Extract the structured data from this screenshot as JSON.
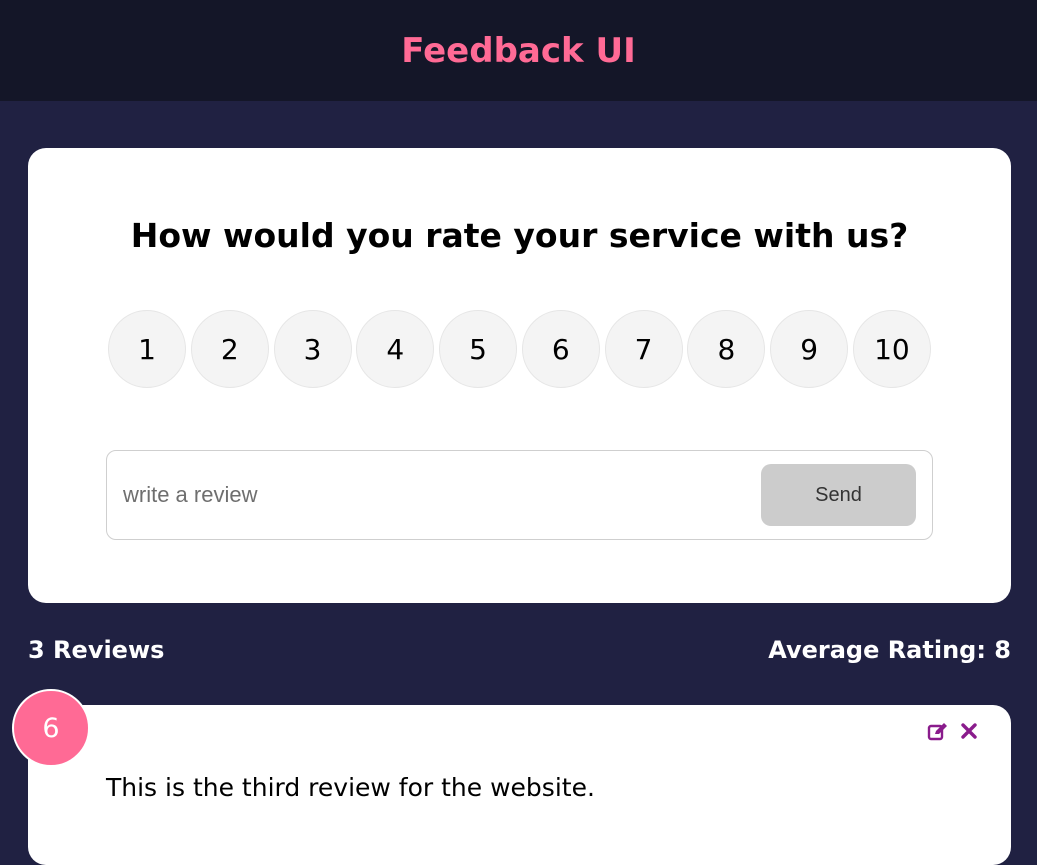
{
  "header": {
    "title": "Feedback UI"
  },
  "form": {
    "question": "How would you rate your service with us?",
    "ratings": [
      "1",
      "2",
      "3",
      "4",
      "5",
      "6",
      "7",
      "8",
      "9",
      "10"
    ],
    "review_placeholder": "write a review",
    "review_value": "",
    "send_label": "Send"
  },
  "stats": {
    "reviews_count": "3 Reviews",
    "average": "Average Rating: 8"
  },
  "reviews": [
    {
      "rating": "6",
      "text": "This is the third review for the website.",
      "edit_icon": "edit-icon",
      "delete_icon": "close-icon"
    }
  ],
  "colors": {
    "accent": "#ff6a95",
    "background": "#202142",
    "header_bg": "#141628",
    "icon": "#8a1c8c"
  }
}
